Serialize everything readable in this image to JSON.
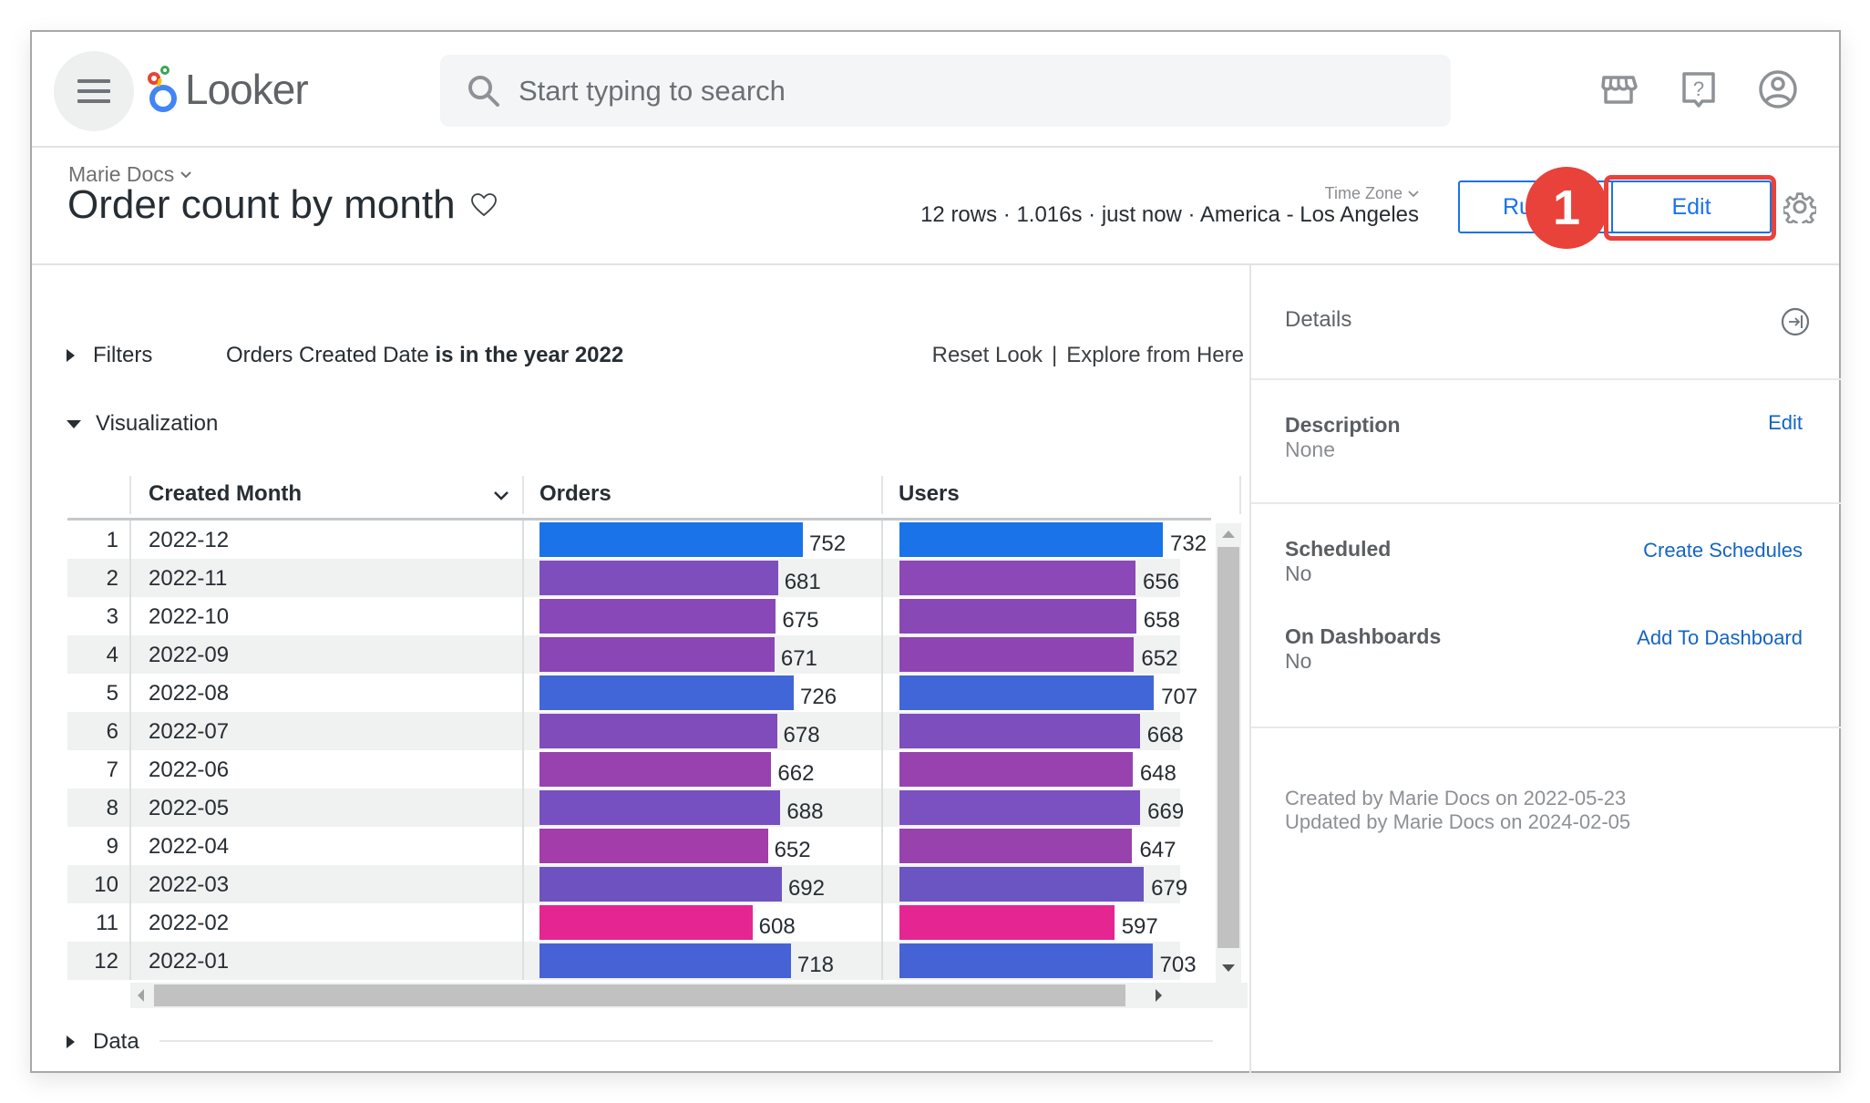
{
  "app": {
    "logo_text": "Looker",
    "search_placeholder": "Start typing to search",
    "nav_icons": [
      "marketplace-icon",
      "help-icon",
      "account-icon"
    ]
  },
  "look": {
    "breadcrumb": "Marie Docs",
    "title": "Order count by month",
    "time_zone_label": "Time Zone",
    "meta": "12 rows · 1.016s · just now · America - Los Angeles",
    "run_label": "Run",
    "edit_label": "Edit",
    "step_badge": "1"
  },
  "main": {
    "filters_label": "Filters",
    "filter_field": "Orders Created Date",
    "filter_condition": "is in the year 2022",
    "reset_look": "Reset Look",
    "separator": "|",
    "explore_from_here": "Explore from Here",
    "visualization_label": "Visualization",
    "data_label": "Data"
  },
  "table": {
    "columns": [
      "Created Month",
      "Orders",
      "Users"
    ],
    "rows": [
      {
        "num": "1",
        "month": "2022-12",
        "orders": 752,
        "users": 732,
        "orders_color": "#1A73E8",
        "users_color": "#1A73E8"
      },
      {
        "num": "2",
        "month": "2022-11",
        "orders": 681,
        "users": 656,
        "orders_color": "#7E4FBC",
        "users_color": "#8B48B6"
      },
      {
        "num": "3",
        "month": "2022-10",
        "orders": 675,
        "users": 658,
        "orders_color": "#8848B8",
        "users_color": "#8849B7"
      },
      {
        "num": "4",
        "month": "2022-09",
        "orders": 671,
        "users": 652,
        "orders_color": "#8B46B5",
        "users_color": "#8E45B3"
      },
      {
        "num": "5",
        "month": "2022-08",
        "orders": 726,
        "users": 707,
        "orders_color": "#4066D8",
        "users_color": "#4066D8"
      },
      {
        "num": "6",
        "month": "2022-07",
        "orders": 678,
        "users": 668,
        "orders_color": "#804CBB",
        "users_color": "#7D4EBD"
      },
      {
        "num": "7",
        "month": "2022-06",
        "orders": 662,
        "users": 648,
        "orders_color": "#9742AF",
        "users_color": "#9742AE"
      },
      {
        "num": "8",
        "month": "2022-05",
        "orders": 688,
        "users": 669,
        "orders_color": "#7650C0",
        "users_color": "#7B50C0"
      },
      {
        "num": "9",
        "month": "2022-04",
        "orders": 652,
        "users": 647,
        "orders_color": "#A23DAA",
        "users_color": "#9842AE"
      },
      {
        "num": "10",
        "month": "2022-03",
        "orders": 692,
        "users": 679,
        "orders_color": "#6E53C0",
        "users_color": "#6B55C2"
      },
      {
        "num": "11",
        "month": "2022-02",
        "orders": 608,
        "users": 597,
        "orders_color": "#E52592",
        "users_color": "#E52592"
      },
      {
        "num": "12",
        "month": "2022-01",
        "orders": 718,
        "users": 703,
        "orders_color": "#4762D4",
        "users_color": "#4663D5"
      }
    ]
  },
  "details": {
    "title": "Details",
    "description_label": "Description",
    "description_value": "None",
    "description_edit": "Edit",
    "scheduled_label": "Scheduled",
    "scheduled_value": "No",
    "create_schedules": "Create Schedules",
    "dashboards_label": "On Dashboards",
    "dashboards_value": "No",
    "add_to_dashboard": "Add To Dashboard",
    "created": "Created by Marie Docs on 2022-05-23",
    "updated": "Updated by Marie Docs on 2024-02-05"
  },
  "colors": {
    "accent": "#1A73E8",
    "highlight": "#E8423A",
    "link": "#1565C0"
  }
}
